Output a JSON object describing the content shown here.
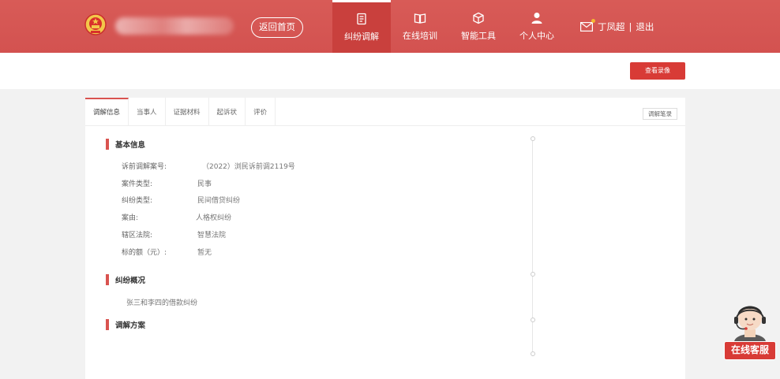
{
  "header": {
    "home_button": "返回首页",
    "nav": [
      {
        "label": "纠纷调解",
        "icon": "document-icon",
        "active": true
      },
      {
        "label": "在线培训",
        "icon": "book-icon"
      },
      {
        "label": "智能工具",
        "icon": "cube-icon"
      },
      {
        "label": "个人中心",
        "icon": "user-icon"
      }
    ],
    "user_name": "丁凤超",
    "separator": "|",
    "logout": "退出"
  },
  "toolbar": {
    "video_button": "查看录像"
  },
  "tabs": [
    "调解信息",
    "当事人",
    "证据材料",
    "起诉状",
    "评价"
  ],
  "record_button": "调解笔录",
  "sections": {
    "basic_info": "基本信息",
    "dispute_overview": "纠纷概况",
    "mediation_plan": "调解方案"
  },
  "basic_info_fields": [
    {
      "label": "诉前调解案号:",
      "value": "（2022）浏民诉前调2119号"
    },
    {
      "label": "案件类型:",
      "value": "民事"
    },
    {
      "label": "纠纷类型:",
      "value": "民间借贷纠纷"
    },
    {
      "label": "案由:",
      "value": "人格权纠纷"
    },
    {
      "label": "辖区法院:",
      "value": "智慧法院"
    },
    {
      "label": "标的额（元）:",
      "value": "暂无"
    }
  ],
  "dispute_overview_text": "张三和李四的借款纠纷",
  "customer_service": "在线客服",
  "colors": {
    "brand_red": "#d9534f",
    "button_red": "#d83b36",
    "badge_yellow": "#f5b731"
  }
}
